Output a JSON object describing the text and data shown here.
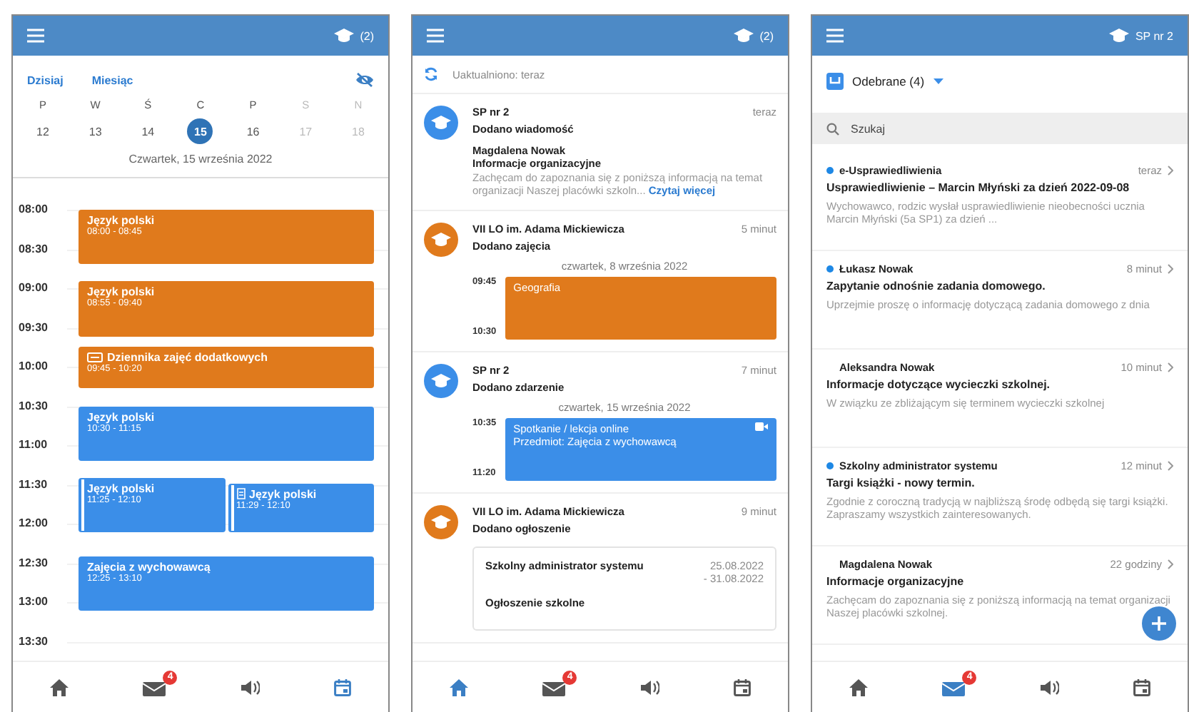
{
  "calendar_screen": {
    "header": {
      "account": "(2)"
    },
    "view_links": [
      "Dzisiaj",
      "Miesiąc"
    ],
    "days": [
      {
        "weekday": "P",
        "date": "12",
        "selected": false,
        "disabled": false
      },
      {
        "weekday": "W",
        "date": "13",
        "selected": false,
        "disabled": false
      },
      {
        "weekday": "Ś",
        "date": "14",
        "selected": false,
        "disabled": false
      },
      {
        "weekday": "C",
        "date": "15",
        "selected": true,
        "disabled": false
      },
      {
        "weekday": "P",
        "date": "16",
        "selected": false,
        "disabled": false
      },
      {
        "weekday": "S",
        "date": "17",
        "selected": false,
        "disabled": true
      },
      {
        "weekday": "N",
        "date": "18",
        "selected": false,
        "disabled": true
      }
    ],
    "date_label": "Czwartek, 15 września 2022",
    "time_labels": [
      "08:00",
      "08:30",
      "09:00",
      "09:30",
      "10:00",
      "10:30",
      "11:00",
      "11:30",
      "12:00",
      "12:30",
      "13:00",
      "13:30"
    ],
    "events": [
      {
        "kind": "plain",
        "title": "Język polski",
        "time": "08:00 - 08:45",
        "color": "#e07a1c"
      },
      {
        "kind": "plain",
        "title": "Język polski",
        "time": "08:55 - 09:40",
        "color": "#e07a1c"
      },
      {
        "kind": "extra",
        "title": "Dziennika zajęć dodatkowych",
        "time": "09:45 - 10:20",
        "color": "#e07a1c"
      },
      {
        "kind": "plain",
        "title": "Język polski",
        "time": "10:30 - 11:15",
        "color": "#3b8ee8"
      },
      {
        "kind": "marked",
        "title": "Język polski",
        "time": "11:25 - 12:10",
        "color": "#3b8ee8"
      },
      {
        "kind": "annotated",
        "title": "Język polski",
        "time": "11:29 - 12:10",
        "color": "#3b8ee8"
      },
      {
        "kind": "plain",
        "title": "Zajęcia z wychowawcą",
        "time": "12:25 - 13:10",
        "color": "#3b8ee8"
      }
    ],
    "nav": [
      {
        "kind": "home",
        "selected": false
      },
      {
        "kind": "mail",
        "selected": false,
        "badge": "4"
      },
      {
        "kind": "speaker",
        "selected": false
      },
      {
        "kind": "calendar",
        "selected": true
      }
    ]
  },
  "feed_screen": {
    "header": {
      "account": "(2)"
    },
    "refresh_status": "Uaktualniono: teraz",
    "items": [
      {
        "kind": "message",
        "school": "SP nr 2",
        "time": "teraz",
        "action": "Dodano wiadomość",
        "color": "#3b8ee8",
        "author": "Magdalena Nowak",
        "subject": "Informacje organizacyjne",
        "excerpt": "Zachęcam do zapoznania się z poniższą informacją na temat organizacji Naszej placówki szkoln...",
        "link": "Czytaj więcej"
      },
      {
        "kind": "lesson",
        "school": "VII LO im. Adama Mickiewicza",
        "time": "5 minut",
        "action": "Dodano zajęcia",
        "color": "#e07a1c",
        "date": "czwartek, 8 września 2022",
        "start": "09:45",
        "end": "10:30",
        "lines": [
          "Geografia"
        ]
      },
      {
        "kind": "event",
        "school": "SP nr 2",
        "time": "7 minut",
        "action": "Dodano zdarzenie",
        "color": "#3b8ee8",
        "date": "czwartek, 15 września 2022",
        "start": "10:35",
        "end": "11:20",
        "lines": [
          "Spotkanie / lekcja online",
          "Przedmiot: Zajęcia z wychowawcą"
        ]
      },
      {
        "kind": "announcement",
        "school": "VII LO im. Adama Mickiewicza",
        "time": "9 minut",
        "action": "Dodano ogłoszenie",
        "color": "#e07a1c",
        "author": "Szkolny administrator systemu",
        "dates": [
          "25.08.2022",
          "- 31.08.2022"
        ],
        "title": "Ogłoszenie szkolne"
      }
    ],
    "nav": [
      {
        "kind": "home",
        "selected": true
      },
      {
        "kind": "mail",
        "selected": false,
        "badge": "4"
      },
      {
        "kind": "speaker",
        "selected": false
      },
      {
        "kind": "calendar",
        "selected": false
      }
    ]
  },
  "messages_screen": {
    "header": {
      "account": "SP nr 2"
    },
    "folder": "Odebrane (4)",
    "search": {
      "placeholder": "Szukaj"
    },
    "messages": [
      {
        "sender": "e-Usprawiedliwienia",
        "time": "teraz",
        "subject": "Usprawiedliwienie – Marcin Młyński za dzień 2022-09-08",
        "excerpt": "Wychowawco, rodzic wysłał usprawiedliwienie nieobecności ucznia Marcin Młyński (5a SP1) za dzień ...",
        "unread": true
      },
      {
        "sender": "Łukasz Nowak",
        "time": "8 minut",
        "subject": "Zapytanie odnośnie zadania domowego.",
        "excerpt": "Uprzejmie proszę o informację dotyczącą zadania domowego z dnia",
        "unread": true
      },
      {
        "sender": "Aleksandra Nowak",
        "time": "10 minut",
        "subject": "Informacje dotyczące wycieczki szkolnej.",
        "excerpt": "W związku ze zbliżającym się terminem wycieczki szkolnej",
        "unread": false
      },
      {
        "sender": "Szkolny administrator systemu",
        "time": "12 minut",
        "subject": "Targi książki - nowy termin.",
        "excerpt": "Zgodnie z coroczną tradycją w najbliższą środę odbędą się targi książki. Zapraszamy wszystkich zainteresowanych.",
        "unread": true
      },
      {
        "sender": "Magdalena Nowak",
        "time": "22 godziny",
        "subject": "Informacje organizacyjne",
        "excerpt": "Zachęcam do zapoznania się z poniższą informacją na temat organizacji Naszej placówki szkolnej.",
        "unread": false
      }
    ],
    "nav": [
      {
        "kind": "home",
        "selected": false
      },
      {
        "kind": "mail",
        "selected": true,
        "badge": "4"
      },
      {
        "kind": "speaker",
        "selected": false
      },
      {
        "kind": "calendar",
        "selected": false
      }
    ]
  }
}
